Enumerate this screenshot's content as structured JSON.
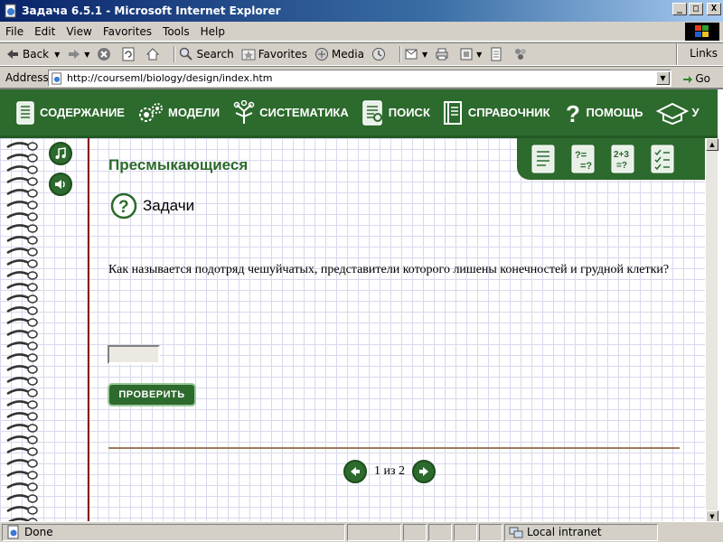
{
  "window": {
    "title": "Задача 6.5.1 - Microsoft Internet Explorer",
    "minimize": "_",
    "maximize": "□",
    "close": "X"
  },
  "menu": [
    {
      "label": "File"
    },
    {
      "label": "Edit"
    },
    {
      "label": "View"
    },
    {
      "label": "Favorites"
    },
    {
      "label": "Tools"
    },
    {
      "label": "Help"
    }
  ],
  "toolbar": {
    "back": "Back",
    "search": "Search",
    "favorites": "Favorites",
    "media": "Media",
    "links": "Links"
  },
  "address": {
    "label": "Address",
    "url": "http://courseml/biology/design/index.htm",
    "go": "Go"
  },
  "nav": {
    "items": [
      {
        "label": "СОДЕРЖАНИЕ",
        "icon": "book-icon"
      },
      {
        "label": "МОДЕЛИ",
        "icon": "gears-icon"
      },
      {
        "label": "СИСТЕМАТИКА",
        "icon": "tree-icon"
      },
      {
        "label": "ПОИСК",
        "icon": "search-doc-icon"
      },
      {
        "label": "СПРАВОЧНИК",
        "icon": "reference-icon"
      },
      {
        "label": "ПОМОЩЬ",
        "icon": "help-icon"
      },
      {
        "label": "У",
        "icon": "graduation-cap-icon"
      }
    ]
  },
  "page": {
    "title": "Пресмыкающиеся",
    "section": "Задачи",
    "question": "Как называется подотряд чешуйчатых, представители которого лишены конечностей и грудной клетки?",
    "answer_value": "",
    "check_button": "ПРОВЕРИТЬ",
    "pager": "1 из 2"
  },
  "status": {
    "text": "Done",
    "zone": "Local intranet"
  },
  "colors": {
    "nav_green": "#2d6a2d",
    "margin_red": "#8b1a1a",
    "grid": "#d9d9ee"
  }
}
